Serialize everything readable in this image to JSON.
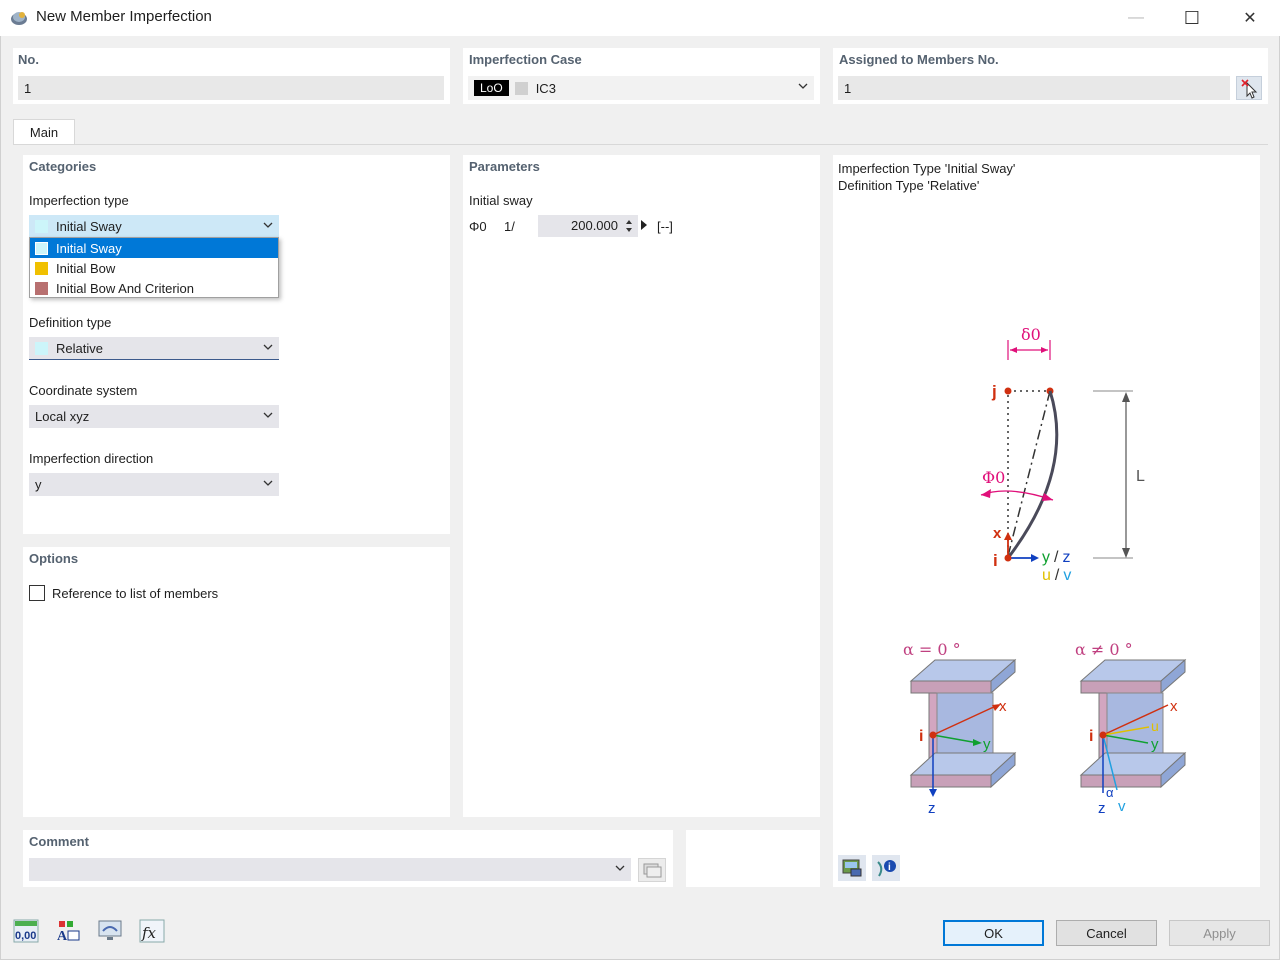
{
  "window": {
    "title": "New Member Imperfection",
    "minimize_glyph": "—",
    "maximize_glyph": "☐",
    "close_glyph": "✕"
  },
  "header": {
    "no_label": "No.",
    "no_value": "1",
    "imperfection_case_label": "Imperfection Case",
    "case_badge": "LoO",
    "case_value": "IC3",
    "assigned_label": "Assigned to Members No.",
    "assigned_value": "1"
  },
  "tabs": [
    {
      "label": "Main"
    }
  ],
  "categories": {
    "title": "Categories",
    "imperfection_type_label": "Imperfection type",
    "imperfection_type_value": "Initial Sway",
    "dropdown_options": [
      {
        "label": "Initial Sway",
        "color": "#ccf5fa",
        "selected": true
      },
      {
        "label": "Initial Bow",
        "color": "#f0c000",
        "selected": false
      },
      {
        "label": "Initial Bow And Criterion",
        "color": "#b87070",
        "selected": false
      }
    ],
    "definition_type_label": "Definition type",
    "definition_type_value": "Relative",
    "coordinate_system_label": "Coordinate system",
    "coordinate_system_value": "Local xyz",
    "imperfection_direction_label": "Imperfection direction",
    "imperfection_direction_value": "y"
  },
  "options": {
    "title": "Options",
    "reference_checkbox_label": "Reference to list of members",
    "reference_checked": false
  },
  "parameters": {
    "title": "Parameters",
    "initial_sway_label": "Initial sway",
    "phi_symbol": "Φ0",
    "fraction_prefix": "1/",
    "phi_value": "200.000",
    "unit": "[--]"
  },
  "preview": {
    "line1": "Imperfection Type 'Initial Sway'",
    "line2": "Definition Type 'Relative'",
    "diagram_labels": {
      "delta": "δ0",
      "j": "j",
      "phi": "Φ0",
      "L": "L",
      "x": "x",
      "i": "i",
      "y_slash_z": "y / z",
      "y_text": "y",
      "slash": "/",
      "z_text": "z",
      "u_text": "u",
      "v_text": "v",
      "alpha_eq": "α = 0 °",
      "alpha_neq": "α ≠ 0 °",
      "alpha": "α"
    }
  },
  "comment": {
    "title": "Comment",
    "value": ""
  },
  "buttons": {
    "ok": "OK",
    "cancel": "Cancel",
    "apply": "Apply"
  },
  "colors": {
    "selection": "#0078d7",
    "header_text": "#556270",
    "magenta": "#e0107a",
    "red_axis": "#d03010",
    "green_axis": "#10a030",
    "blue_axis": "#1040c0",
    "yellow_axis": "#e0c000",
    "cyan_axis": "#20a0e0"
  }
}
